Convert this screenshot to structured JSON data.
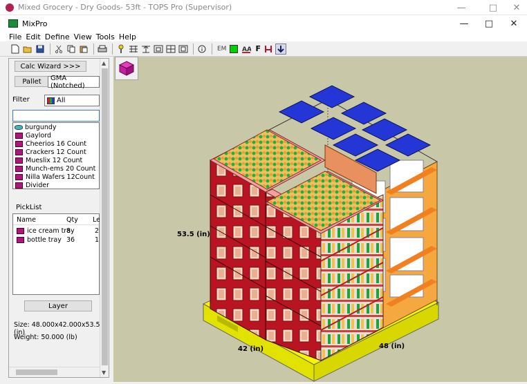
{
  "outer_window": {
    "title": "Mixed Grocery - Dry Goods- 53ft - TOPS Pro (Supervisor)"
  },
  "inner_window": {
    "title": "MixPro"
  },
  "menu": [
    "File",
    "Edit",
    "Define",
    "View",
    "Tools",
    "Help"
  ],
  "toolbar": {
    "em_label": "EM",
    "f_label": "F"
  },
  "left": {
    "calc_wizard": "Calc Wizard >>>",
    "pallet_button": "Pallet",
    "pallet_value": "GMA (Notched)",
    "filter_label": "Filter",
    "filter_value": "All",
    "products": [
      {
        "name": "burgundy",
        "icon": "tray-icon"
      },
      {
        "name": "Gaylord",
        "icon": "box-icon"
      },
      {
        "name": "Cheerios 16 Count",
        "icon": "box-icon"
      },
      {
        "name": "Crackers 12 Count",
        "icon": "box-icon"
      },
      {
        "name": "Mueslix 12 Count",
        "icon": "box-icon"
      },
      {
        "name": "Munch-ems 20 Count",
        "icon": "box-icon"
      },
      {
        "name": "Nilla Wafers 12Count",
        "icon": "box-icon"
      },
      {
        "name": "Divider",
        "icon": "box-icon"
      }
    ],
    "picklist_label": "PickList",
    "picklist_headers": [
      "Name",
      "Qty",
      "Le"
    ],
    "picklist_rows": [
      {
        "name": "ice cream tray",
        "qty": "8",
        "le": "2"
      },
      {
        "name": "bottle tray alt...",
        "qty": "36",
        "le": "1"
      }
    ],
    "layer_button": "Layer",
    "size": "Size: 48.000x42.000x53.500 (in)",
    "weight": "Weight: 50.000 (lb)"
  },
  "viewport": {
    "height_label": "53.5 (in)",
    "width_label": "42 (in)",
    "depth_label": "48 (in)"
  },
  "colors": {
    "viewport_bg": "#c8c8a8",
    "pallet": "#f2f200",
    "crate": "#b01020",
    "bottle_green": "#20a040",
    "ice_cream_lid": "#2030d0",
    "tray_orange": "#f08020"
  }
}
